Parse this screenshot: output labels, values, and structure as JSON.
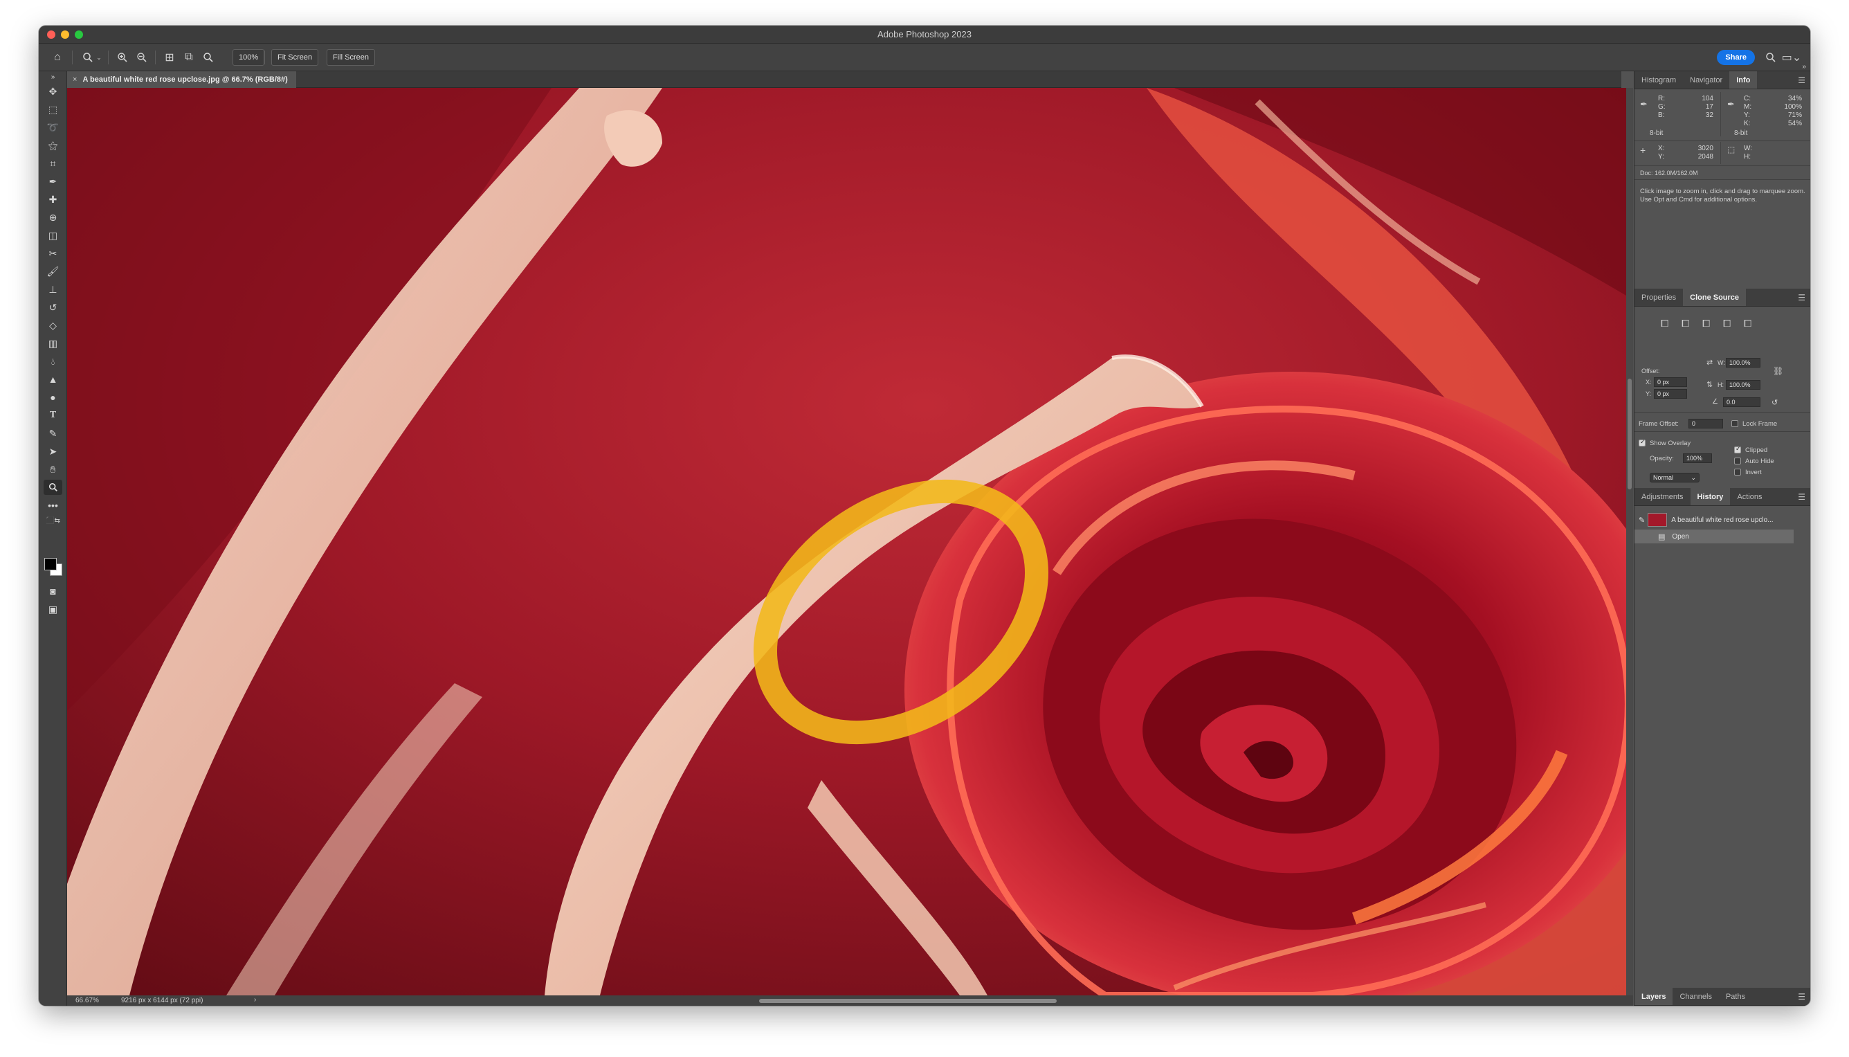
{
  "app": {
    "title": "Adobe Photoshop 2023"
  },
  "options_bar": {
    "zoom_value": "100%",
    "fit_screen": "Fit Screen",
    "fill_screen": "Fill Screen",
    "share": "Share"
  },
  "document": {
    "tab_title": "A beautiful white red rose upclose.jpg @ 66.7% (RGB/8#)",
    "close_glyph": "×"
  },
  "status": {
    "zoom": "66.67%",
    "doc_info": "9216 px x 6144 px (72 ppi)",
    "arrow": "›"
  },
  "info_panel": {
    "tabs": [
      "Histogram",
      "Navigator",
      "Info"
    ],
    "active_tab": "Info",
    "rgb": {
      "R_label": "R:",
      "R": "104",
      "G_label": "G:",
      "G": "17",
      "B_label": "B:",
      "B": "32"
    },
    "cmyk": {
      "C_label": "C:",
      "C": "34%",
      "M_label": "M:",
      "M": "100%",
      "Y_label": "Y:",
      "Y": "71%",
      "K_label": "K:",
      "K": "54%"
    },
    "bit_left": "8-bit",
    "bit_right": "8-bit",
    "xy": {
      "X_label": "X:",
      "X": "3020",
      "Y_label": "Y:",
      "Y": "2048"
    },
    "wh": {
      "W_label": "W:",
      "H_label": "H:"
    },
    "doc": "Doc: 162.0M/162.0M",
    "hint": "Click image to zoom in, click and drag to marquee zoom.  Use Opt and Cmd for additional options."
  },
  "clone_panel": {
    "tabs": [
      "Properties",
      "Clone Source"
    ],
    "active_tab": "Clone Source",
    "offset_label": "Offset:",
    "x_label": "X:",
    "x_value": "0 px",
    "y_label": "Y:",
    "y_value": "0 px",
    "w_label": "W:",
    "w_value": "100.0%",
    "h_label": "H:",
    "h_value": "100.0%",
    "angle_value": "0.0",
    "frame_offset_label": "Frame Offset:",
    "frame_offset_value": "0",
    "lock_frame": "Lock Frame",
    "show_overlay": "Show Overlay",
    "opacity_label": "Opacity:",
    "opacity_value": "100%",
    "clipped": "Clipped",
    "auto_hide": "Auto Hide",
    "invert": "Invert",
    "blend_mode": "Normal"
  },
  "history_panel": {
    "tabs": [
      "Adjustments",
      "History",
      "Actions"
    ],
    "active_tab": "History",
    "snapshot_label": "A beautiful white red rose upclo...",
    "items": [
      "Open"
    ]
  },
  "layers_panel": {
    "tabs": [
      "Layers",
      "Channels",
      "Paths"
    ],
    "active_tab": "Layers"
  },
  "colors": {
    "accent": "#1473e6",
    "panel_bg": "#535353",
    "highlight_circle": "#f2b81a"
  },
  "tools": [
    "move-tool",
    "marquee-tool",
    "lasso-tool",
    "magic-wand-tool",
    "crop-tool",
    "eyedropper-tool",
    "spot-healing-tool",
    "healing-brush-tool",
    "patch-tool",
    "content-aware-move-tool",
    "brush-tool",
    "clone-stamp-tool",
    "history-brush-tool",
    "eraser-tool",
    "gradient-tool",
    "blur-tool",
    "sharpen-tool",
    "dodge-tool",
    "type-tool",
    "pen-tool",
    "path-selection-tool",
    "hand-tool",
    "zoom-tool",
    "more-tools"
  ]
}
